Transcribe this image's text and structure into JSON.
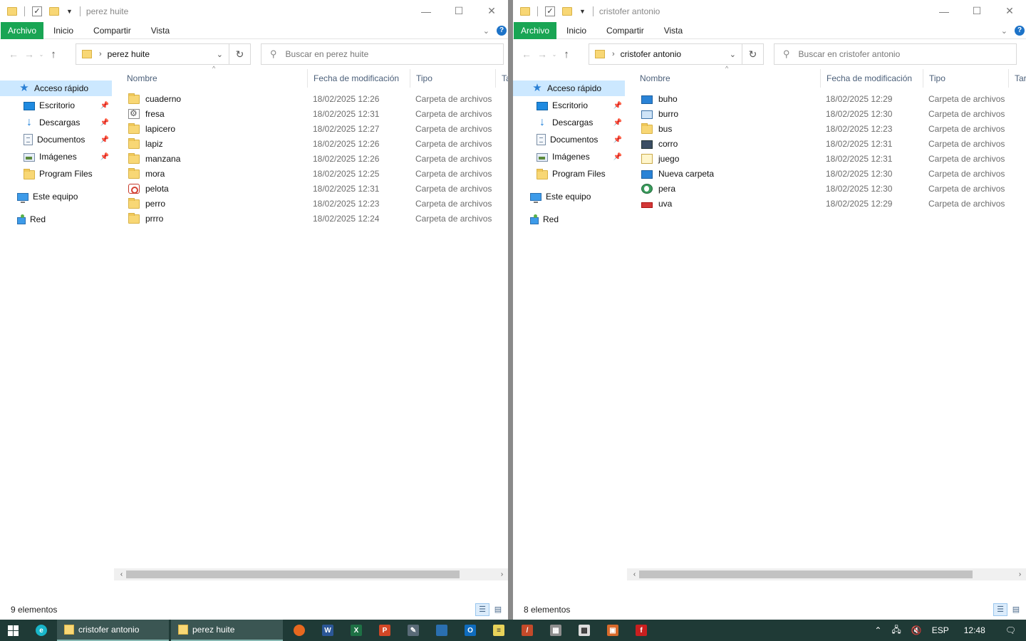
{
  "left": {
    "title": "perez huite",
    "tabs": [
      "Archivo",
      "Inicio",
      "Compartir",
      "Vista"
    ],
    "crumb": "perez huite",
    "search_placeholder": "Buscar en perez huite",
    "columns": [
      "Nombre",
      "Fecha de modificación",
      "Tipo",
      "Tar"
    ],
    "nav": [
      "Acceso rápido",
      "Escritorio",
      "Descargas",
      "Documentos",
      "Imágenes",
      "Program Files",
      "Este equipo",
      "Red"
    ],
    "files": [
      {
        "name": "cuaderno",
        "date": "18/02/2025 12:26",
        "type": "Carpeta de archivos",
        "icon": "folder"
      },
      {
        "name": "fresa",
        "date": "18/02/2025 12:31",
        "type": "Carpeta de archivos",
        "icon": "gear"
      },
      {
        "name": "lapicero",
        "date": "18/02/2025 12:27",
        "type": "Carpeta de archivos",
        "icon": "folder"
      },
      {
        "name": "lapiz",
        "date": "18/02/2025 12:26",
        "type": "Carpeta de archivos",
        "icon": "folder"
      },
      {
        "name": "manzana",
        "date": "18/02/2025 12:26",
        "type": "Carpeta de archivos",
        "icon": "folder"
      },
      {
        "name": "mora",
        "date": "18/02/2025 12:25",
        "type": "Carpeta de archivos",
        "icon": "folder"
      },
      {
        "name": "pelota",
        "date": "18/02/2025 12:31",
        "type": "Carpeta de archivos",
        "icon": "red"
      },
      {
        "name": "perro",
        "date": "18/02/2025 12:23",
        "type": "Carpeta de archivos",
        "icon": "folder"
      },
      {
        "name": "prrro",
        "date": "18/02/2025 12:24",
        "type": "Carpeta de archivos",
        "icon": "folder"
      }
    ],
    "status": "9 elementos"
  },
  "right": {
    "title": "cristofer antonio",
    "tabs": [
      "Archivo",
      "Inicio",
      "Compartir",
      "Vista"
    ],
    "crumb": "cristofer antonio",
    "search_placeholder": "Buscar en cristofer antonio",
    "columns": [
      "Nombre",
      "Fecha de modificación",
      "Tipo",
      "Tar"
    ],
    "nav": [
      "Acceso rápido",
      "Escritorio",
      "Descargas",
      "Documentos",
      "Imágenes",
      "Program Files",
      "Este equipo",
      "Red"
    ],
    "files": [
      {
        "name": "buho",
        "date": "18/02/2025 12:29",
        "type": "Carpeta de archivos",
        "icon": "monitor"
      },
      {
        "name": "burro",
        "date": "18/02/2025 12:30",
        "type": "Carpeta de archivos",
        "icon": "monitor2"
      },
      {
        "name": "bus",
        "date": "18/02/2025 12:23",
        "type": "Carpeta de archivos",
        "icon": "folder"
      },
      {
        "name": "corro",
        "date": "18/02/2025 12:31",
        "type": "Carpeta de archivos",
        "icon": "dark"
      },
      {
        "name": "juego",
        "date": "18/02/2025 12:31",
        "type": "Carpeta de archivos",
        "icon": "note"
      },
      {
        "name": "Nueva carpeta",
        "date": "18/02/2025 12:30",
        "type": "Carpeta de archivos",
        "icon": "monitor"
      },
      {
        "name": "pera",
        "date": "18/02/2025 12:30",
        "type": "Carpeta de archivos",
        "icon": "globe"
      },
      {
        "name": "uva",
        "date": "18/02/2025 12:29",
        "type": "Carpeta de archivos",
        "icon": "redcar"
      }
    ],
    "status": "8 elementos"
  },
  "taskbar": {
    "tasks": [
      "cristofer antonio",
      "perez huite"
    ],
    "lang": "ESP",
    "time": "12:48",
    "app_icons": [
      "firefox-icon",
      "word-icon",
      "excel-icon",
      "powerpoint-icon",
      "tool-icon",
      "monitor-icon",
      "outlook-icon",
      "notes-icon",
      "pen-icon",
      "archive-icon",
      "grid-icon",
      "box-icon",
      "flash-icon"
    ]
  }
}
